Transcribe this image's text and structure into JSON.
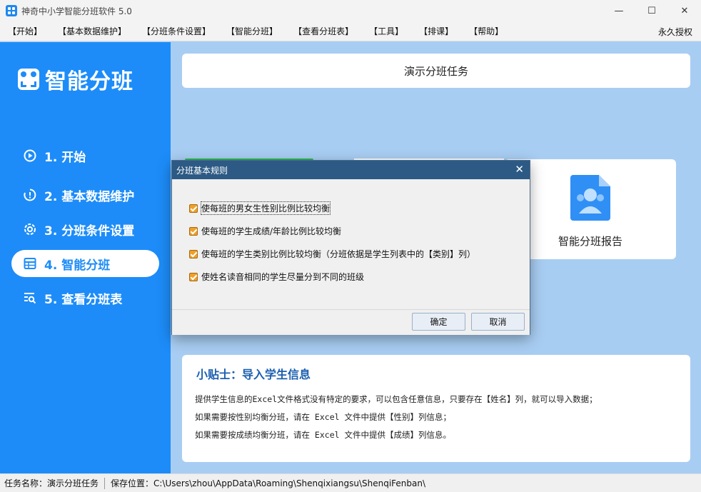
{
  "window": {
    "title": "神奇中小学智能分班软件 5.0",
    "minimize": "—",
    "maximize": "☐",
    "close": "✕"
  },
  "menu": {
    "items": [
      "【开始】",
      "【基本数据维护】",
      "【分班条件设置】",
      "【智能分班】",
      "【查看分班表】",
      "【工具】",
      "【排课】",
      "【帮助】"
    ],
    "license": "永久授权"
  },
  "sidebar": {
    "logo_text": "智能分班",
    "items": [
      {
        "label": "1. 开始",
        "icon": "play-circle-icon"
      },
      {
        "label": "2. 基本数据维护",
        "icon": "clock-info-icon"
      },
      {
        "label": "3. 分班条件设置",
        "icon": "gear-icon"
      },
      {
        "label": "4. 智能分班",
        "icon": "table-icon"
      },
      {
        "label": "5. 查看分班表",
        "icon": "list-search-icon"
      }
    ],
    "active_index": 3
  },
  "main": {
    "task_title": "演示分班任务",
    "report_card_label": "智能分班报告",
    "tips": {
      "title": "小贴士：导入学生信息",
      "lines": [
        "提供学生信息的Excel文件格式没有特定的要求，可以包含任意信息，只要存在【姓名】列，就可以导入数据；",
        "如果需要按性别均衡分班，请在 Excel 文件中提供【性别】列信息；",
        "如果需要按成绩均衡分班，请在 Excel 文件中提供【成绩】列信息。"
      ]
    }
  },
  "dialog": {
    "title": "分班基本规则",
    "close": "✕",
    "rules": [
      {
        "label": "使每班的男女生性别比例比较均衡",
        "checked": true
      },
      {
        "label": "使每班的学生成绩/年龄比例比较均衡",
        "checked": true
      },
      {
        "label": "使每班的学生类别比例比较均衡（分班依据是学生列表中的【类别】列）",
        "checked": true
      },
      {
        "label": "使姓名读音相同的学生尽量分到不同的班级",
        "checked": true
      }
    ],
    "ok": "确定",
    "cancel": "取消"
  },
  "status": {
    "task_label": "任务名称：演示分班任务",
    "path_label": "保存位置：C:\\Users\\zhou\\AppData\\Roaming\\Shenqixiangsu\\ShenqiFenban\\"
  },
  "colors": {
    "accent": "#1d8cf8",
    "dialog_title": "#2c5a84",
    "tips_title": "#1b5fb0"
  }
}
